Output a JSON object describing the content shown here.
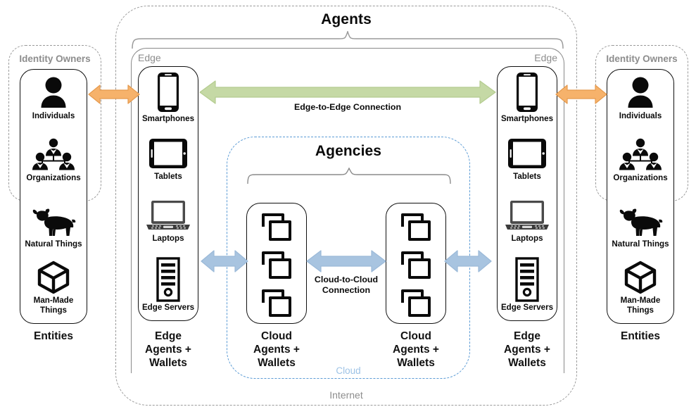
{
  "diagram": {
    "title": "Agents",
    "outer_label": "Internet",
    "cloud_label": "Cloud",
    "agencies_label": "Agencies",
    "edge_label_left": "Edge",
    "edge_label_right": "Edge"
  },
  "identity_owners_left": {
    "header": "Identity Owners",
    "footer": "Entities",
    "items": [
      {
        "label": "Individuals",
        "icon": "person-icon"
      },
      {
        "label": "Organizations",
        "icon": "organization-group-icon"
      },
      {
        "label": "Natural Things",
        "icon": "cow-icon"
      },
      {
        "label": "Man-Made\nThings",
        "icon": "cube-icon"
      }
    ]
  },
  "identity_owners_right": {
    "header": "Identity Owners",
    "footer": "Entities",
    "items": [
      {
        "label": "Individuals",
        "icon": "person-icon"
      },
      {
        "label": "Organizations",
        "icon": "organization-group-icon"
      },
      {
        "label": "Natural Things",
        "icon": "cow-icon"
      },
      {
        "label": "Man-Made\nThings",
        "icon": "cube-icon"
      }
    ]
  },
  "edge_agents_left": {
    "footer": "Edge\nAgents +\nWallets",
    "items": [
      {
        "label": "Smartphones",
        "icon": "smartphone-icon"
      },
      {
        "label": "Tablets",
        "icon": "tablet-icon"
      },
      {
        "label": "Laptops",
        "icon": "laptop-icon"
      },
      {
        "label": "Edge Servers",
        "icon": "server-tower-icon"
      }
    ]
  },
  "edge_agents_right": {
    "footer": "Edge\nAgents +\nWallets",
    "items": [
      {
        "label": "Smartphones",
        "icon": "smartphone-icon"
      },
      {
        "label": "Tablets",
        "icon": "tablet-icon"
      },
      {
        "label": "Laptops",
        "icon": "laptop-icon"
      },
      {
        "label": "Edge Servers",
        "icon": "server-tower-icon"
      }
    ]
  },
  "cloud_agents_left": {
    "footer": "Cloud\nAgents +\nWallets",
    "icon_count": 3,
    "icon": "stacked-windows-icon"
  },
  "cloud_agents_right": {
    "footer": "Cloud\nAgents +\nWallets",
    "icon_count": 3,
    "icon": "stacked-windows-icon"
  },
  "connections": {
    "edge_to_edge": "Edge-to-Edge Connection",
    "cloud_to_cloud": "Cloud-to-Cloud\nConnection"
  },
  "colors": {
    "orange_arrow": "#F6B26B",
    "orange_arrow_stroke": "#E59A4E",
    "green_arrow": "#C5D9A5",
    "green_arrow_stroke": "#B4CC90",
    "blue_arrow": "#A8C4E0",
    "blue_arrow_stroke": "#9BB9D8",
    "cloud_dashed": "#5B9BD5",
    "gray_dashed": "#9A9A9A",
    "cloud_text": "#9DC3E6",
    "gray_text": "#8D8D8D"
  }
}
